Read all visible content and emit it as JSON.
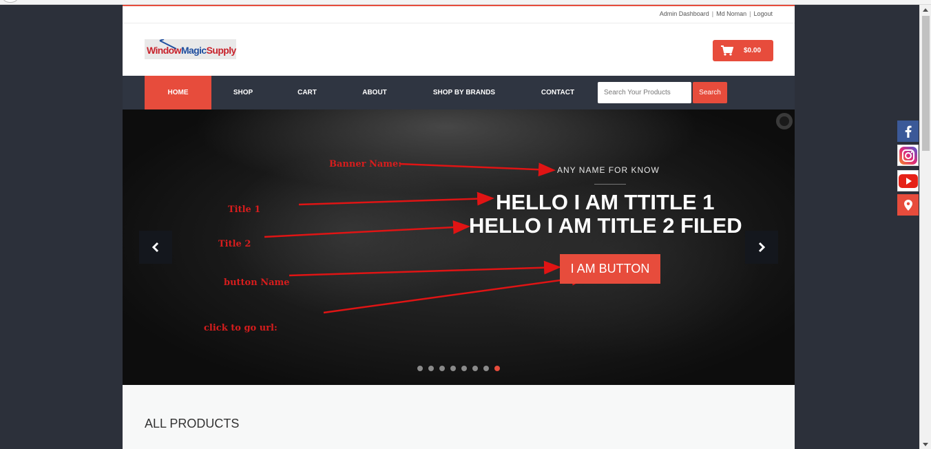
{
  "topbar": {
    "admin_link": "Admin Dashboard",
    "user_link": "Md Noman",
    "logout_link": "Logout",
    "separator": "|"
  },
  "header": {
    "logo_text_red": "Window",
    "logo_text_blue": "Magic",
    "logo_text_red2": "Supply",
    "cart_amount": "$0.00",
    "cart_icon": "cart-icon"
  },
  "nav": {
    "items": [
      "HOME",
      "SHOP",
      "CART",
      "ABOUT",
      "SHOP BY BRANDS",
      "CONTACT"
    ],
    "active": "HOME",
    "search_placeholder": "Search Your Products",
    "search_button": "Search"
  },
  "banner": {
    "banner_name": "ANY NAME FOR KNOW",
    "title1": "HELLO I AM TTITLE 1",
    "title2": "HELLO I AM TITLE 2 FILED",
    "button": "I AM BUTTON",
    "dots_total": 8,
    "active_dot": 8,
    "prev_icon": "chevron-left-icon",
    "next_icon": "chevron-right-icon"
  },
  "annotations": {
    "banner_name": "Banner Name:",
    "title1": "Title 1",
    "title2": "Title 2",
    "button_name": "button Name",
    "click_url": "click to go url:"
  },
  "section": {
    "title": "ALL PRODUCTS"
  },
  "social": [
    "facebook-icon",
    "instagram-icon",
    "youtube-icon",
    "location-icon"
  ],
  "colors": {
    "accent": "#e74c3c",
    "nav_bg": "#2f3541",
    "page_bg": "#2c303a",
    "annotation": "#d61d1d"
  }
}
